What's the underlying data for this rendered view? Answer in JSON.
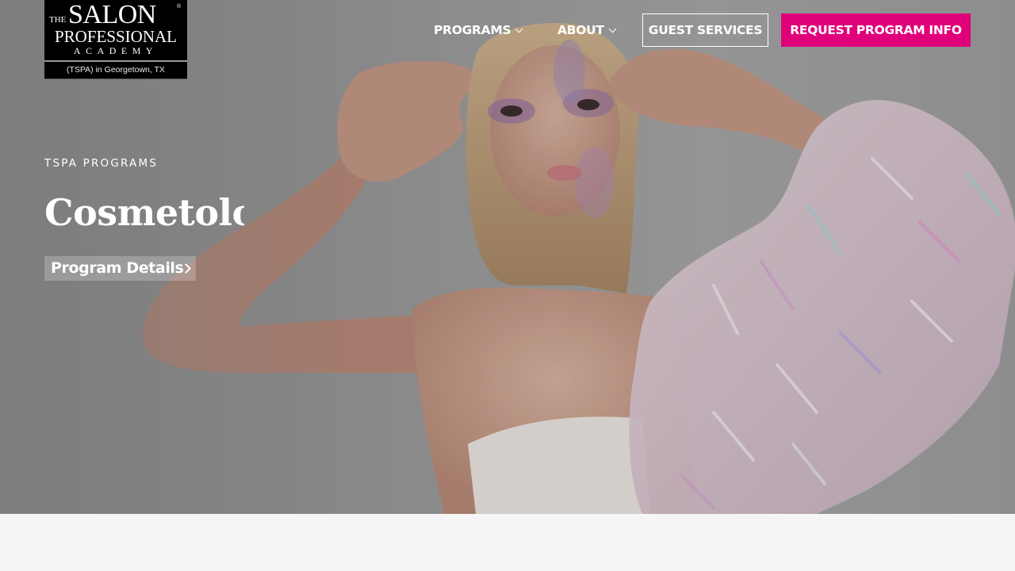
{
  "logo": {
    "the": "THE",
    "salon": "SALON",
    "registered": "®",
    "professional": "PROFESSIONAL",
    "academy": "ACADEMY",
    "location": "(TSPA) in Georgetown, TX"
  },
  "nav": {
    "programs_label": "PROGRAMS",
    "about_label": "ABOUT",
    "guest_services_label": "GUEST SERVICES",
    "request_info_label": "REQUEST PROGRAM INFO"
  },
  "hero": {
    "eyebrow": "TSPA PROGRAMS",
    "headline": "Cosmetolo",
    "details_label": "Program Details"
  },
  "colors": {
    "accent": "#e0007a",
    "footer_bg": "#f5f5f5"
  },
  "icons": {
    "programs_dropdown": "chevron-down-icon",
    "about_dropdown": "chevron-down-icon",
    "details_arrow": "chevron-right-icon"
  }
}
